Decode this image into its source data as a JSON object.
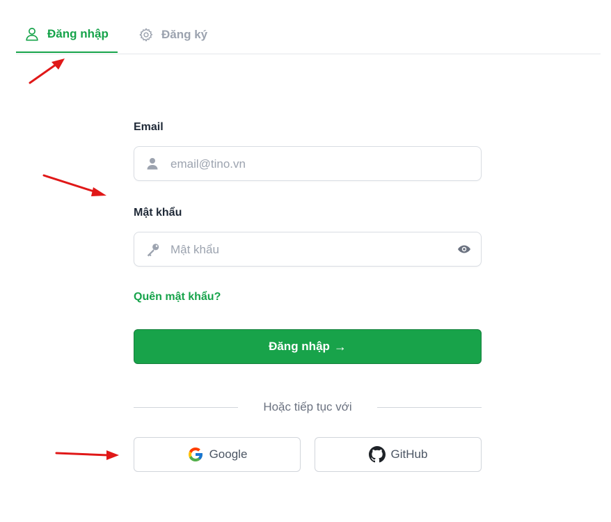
{
  "tabs": {
    "login_label": "Đăng nhập",
    "register_label": "Đăng ký"
  },
  "form": {
    "email_label": "Email",
    "email_placeholder": "email@tino.vn",
    "password_label": "Mật khẩu",
    "password_placeholder": "Mật khẩu",
    "forgot_label": "Quên mật khẩu?",
    "submit_label": "Đăng nhập",
    "submit_arrow": "→"
  },
  "social": {
    "divider_text": "Hoặc tiếp tục với",
    "google_label": "Google",
    "github_label": "GitHub"
  },
  "colors": {
    "accent": "#16a34a",
    "annotation_arrow": "#e01818"
  }
}
